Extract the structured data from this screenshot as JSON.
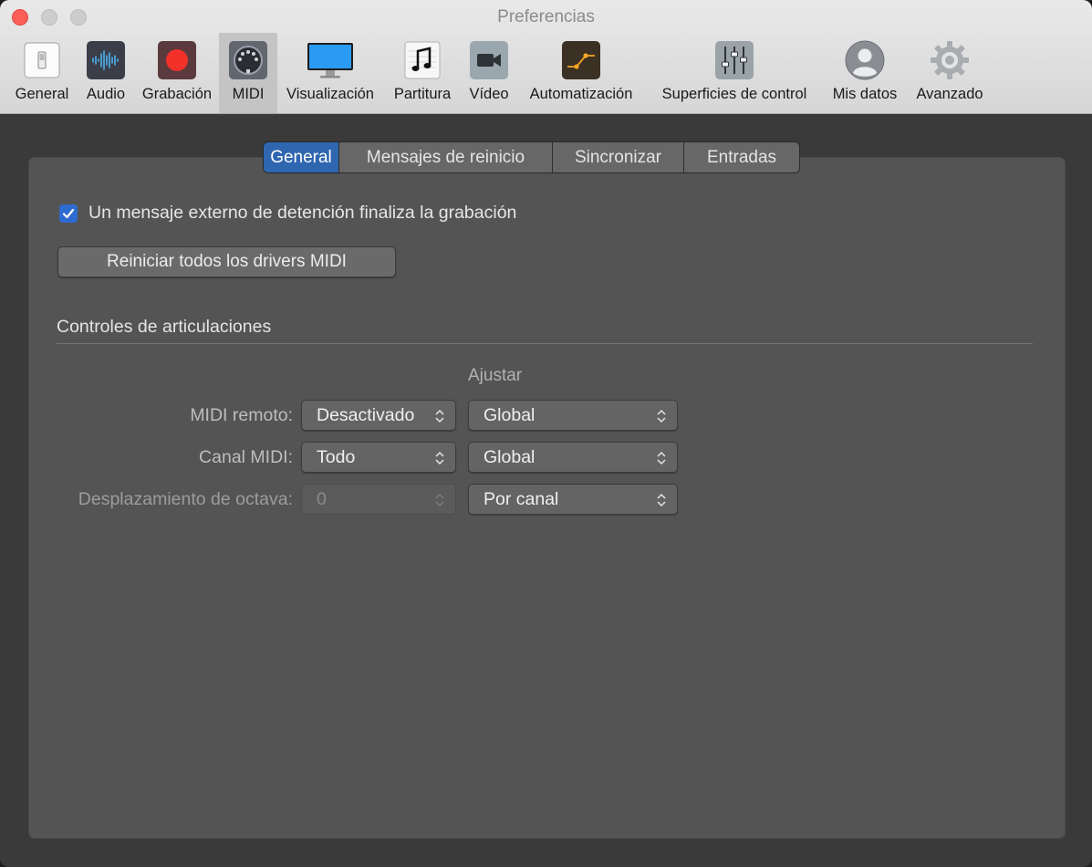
{
  "window": {
    "title": "Preferencias"
  },
  "toolbar": {
    "items": [
      {
        "label": "General",
        "icon": "general-icon"
      },
      {
        "label": "Audio",
        "icon": "audio-waveform-icon"
      },
      {
        "label": "Grabación",
        "icon": "record-icon"
      },
      {
        "label": "MIDI",
        "icon": "midi-connector-icon",
        "selected": true
      },
      {
        "label": "Visualización",
        "icon": "display-monitor-icon"
      },
      {
        "label": "Partitura",
        "icon": "music-note-icon"
      },
      {
        "label": "Vídeo",
        "icon": "video-camera-icon"
      },
      {
        "label": "Automatización",
        "icon": "automation-icon"
      },
      {
        "label": "Superficies de control",
        "icon": "faders-icon"
      },
      {
        "label": "Mis datos",
        "icon": "user-icon"
      },
      {
        "label": "Avanzado",
        "icon": "gear-icon"
      }
    ]
  },
  "tabs": {
    "items": [
      {
        "label": "General",
        "active": true
      },
      {
        "label": "Mensajes de reinicio"
      },
      {
        "label": "Sincronizar"
      },
      {
        "label": "Entradas"
      }
    ]
  },
  "general": {
    "stop_message_checkbox": {
      "label": "Un mensaje externo de detención finaliza la grabación",
      "checked": true
    },
    "reset_button_label": "Reiniciar todos los drivers MIDI",
    "articulation_section_title": "Controles de articulaciones",
    "adjust_heading": "Ajustar",
    "rows": [
      {
        "label": "MIDI remoto:",
        "value": "Desactivado",
        "adjust": "Global"
      },
      {
        "label": "Canal MIDI:",
        "value": "Todo",
        "adjust": "Global"
      },
      {
        "label": "Desplazamiento de octava:",
        "value": "0",
        "adjust": "Por canal",
        "value_disabled": true
      }
    ]
  },
  "colors": {
    "accent": "#2f66b0",
    "close_button": "#fc5f57",
    "record_red": "#f23128",
    "panel": "#545454"
  }
}
